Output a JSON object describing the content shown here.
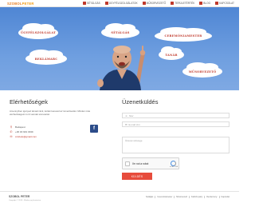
{
  "brand": {
    "name_a": "SZOBOL",
    "name_b": "PETER"
  },
  "nav": [
    {
      "label": "SÉTÁLGÁS",
      "icon": "walk-icon"
    },
    {
      "label": "ÜGYFÉLSZOLGÁLATOK",
      "icon": "service-icon"
    },
    {
      "label": "MŰSORVEZETŐ",
      "icon": "mic-icon"
    },
    {
      "label": "TERÜLETÉRTÉK",
      "icon": "area-icon"
    },
    {
      "label": "BLOG",
      "icon": "blog-icon"
    },
    {
      "label": "KAPCSOLAT",
      "icon": "contact-icon"
    }
  ],
  "hero": {
    "clouds": [
      "ÜGYFÉLSZOLGÁLAT",
      "SÉTÁLGÁS",
      "CEREMÓNIAMESTER",
      "TANÁR",
      "REKLÁMARC",
      "MŰSORVEZETŐ"
    ]
  },
  "contact": {
    "title": "Elérhetőségek",
    "description": "Amennyiben igényed támad ránk, kérlek kereséd az ismerőseidet. Minden más elérhetőségeim is itt vannak szeretettel.",
    "city": "Budapest",
    "phone": "+36 30 943 3339",
    "email": "szobolp@gmail.com"
  },
  "form": {
    "title": "Üzenetküldés",
    "name_placeholder": "Név",
    "email_placeholder": "E-mail cím",
    "message_placeholder": "Üzenet szövege",
    "captcha_label": "I'm not a robot",
    "captcha_brand": "reCAPTCHA",
    "submit_label": "KÜLDÉS"
  },
  "footer": {
    "logo": "SZOBOL PETER",
    "copyright": "Copyright © 2019 - Minden jog fenntartva",
    "links": [
      "Sétálgás",
      "Ceremóniamester",
      "Műsorvezető",
      "Kattinfo-party",
      "Rendezvény",
      "Kapcsolat"
    ]
  },
  "colors": {
    "accent": "#c0392b",
    "submit": "#e74c3c",
    "hero": "#5b8fda",
    "facebook": "#2c4c89"
  }
}
